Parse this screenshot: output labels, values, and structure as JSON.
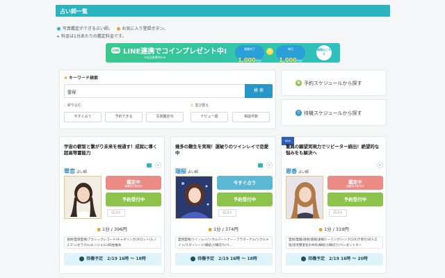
{
  "header": {
    "title": "占い師一覧"
  },
  "notes": {
    "line1_a": "写真鑑定ができる占い師。",
    "line1_b": "お気に入り登録ボタン。",
    "line2": "料金は1分あたりの鑑定料金です。",
    "dot_a_color": "#2bb3c0",
    "dot_b_color": "#e5a23b",
    "dot_c_color": "#999999"
  },
  "banner": {
    "line_badge": "LINE",
    "main": "LINE連携でコインプレゼント中!",
    "sub": "※初回連携時のみ",
    "coin1_label": "連携完了",
    "coin1_value": "1,000",
    "coin1_unit": "円分",
    "plus": "+",
    "coin2_label": "毎月",
    "coin2_value": "1,000",
    "coin2_unit": "円分",
    "detail": "連携はこちら"
  },
  "search": {
    "title": "キーワード検索",
    "input_value": "霊視",
    "button": "検 索",
    "narrow_label": "絞り込む",
    "sort_label": "並び替え",
    "filters": [
      "今すぐ占う",
      "予約できる",
      "写真鑑定可"
    ],
    "sorts": [
      "デビュー順",
      "相談件数"
    ]
  },
  "schedule": {
    "reserve": "予約スケジュールから探す",
    "standby": "待機スケジュールから探す"
  },
  "cards": [
    {
      "headline": "宇宙の叡智と繋がり未来を視通す！成就に導く超高等霊能力",
      "name": "翠恋",
      "role": "占い師",
      "status1": "鑑定中",
      "status1_sub": "順番待ち受付中",
      "status2": "予約受付中",
      "review": "口コミ",
      "price": "1分 / 396円",
      "tags": "透視/霊感霊視/アカシックレコード/チャネリング/タロット(ルノルマン/オラクル/エンジェル)/四柱推命",
      "wait": "待機予定　2/19 16時 〜 18時"
    },
    {
      "headline": "幾多の難生を実現！運破りのツインレイで恋愛中",
      "name": "瑞桜",
      "role": "占い師",
      "status1": "今すぐ占う",
      "status2": "予約受付中",
      "review": "口コミ",
      "price": "1分 / 374円",
      "tags": "霊感霊視/ツインレイ/ソウルパートナー・フラターナル/ソウルメイト/スターシード/縁結び/縁切り/ペ...",
      "wait": "待機予定　2/19 16時 〜 18時"
    },
    {
      "badge": "NEW",
      "headline": "驚異の願望実現力でリピーター続出！絶望的な悩みをも解決へ",
      "name": "恩香",
      "role": "占い師",
      "status1": "鑑定中",
      "status1_sub": "順番待ち受付中",
      "status2": "予約受付中",
      "review": "口コミ",
      "price": "1分 / 319円",
      "tags": "霊視/霊聴/透視/遠隔/遠隔ヒーリング/シンクロ/引き寄せ/対人工程/思考簡潔化の共有/縁結び/縁切り/ペンダントター",
      "wait": "待機予定　2/19 16時 〜 20時"
    }
  ]
}
